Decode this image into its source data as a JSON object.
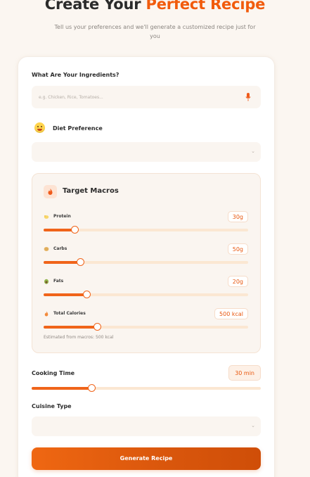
{
  "header": {
    "title_part1": "Create Your ",
    "title_accent": "Perfect Recipe",
    "subtitle": "Tell us your preferences and we'll generate a customized recipe just for you"
  },
  "ingredients": {
    "label": "What Are Your Ingredients?",
    "placeholder": "e.g. Chicken, Rice, Tomatoes...",
    "value": ""
  },
  "diet": {
    "label": "Diet Preference",
    "value": ""
  },
  "macros": {
    "title": "Target Macros",
    "items": [
      {
        "label": "Protein",
        "value": "30g",
        "fraction": 0.15
      },
      {
        "label": "Carbs",
        "value": "50g",
        "fraction": 0.18
      },
      {
        "label": "Fats",
        "value": "20g",
        "fraction": 0.21
      },
      {
        "label": "Total Calories",
        "value": "500 kcal",
        "fraction": 0.26
      }
    ],
    "estimate": "Estimated from macros: 500 kcal"
  },
  "cooking_time": {
    "label": "Cooking Time",
    "value": "30 min",
    "fraction": 0.26
  },
  "cuisine": {
    "label": "Cuisine Type",
    "value": ""
  },
  "actions": {
    "generate_label": "Generate Recipe"
  },
  "colors": {
    "accent": "#f15b0c",
    "track": "#fbe7d2",
    "background": "#fbf6f1"
  }
}
